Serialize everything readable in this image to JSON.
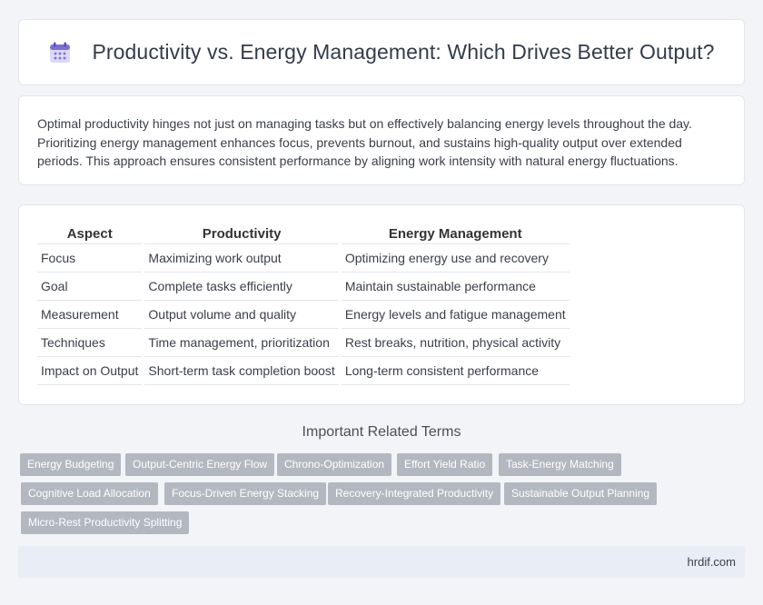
{
  "header": {
    "title": "Productivity vs. Energy Management: Which Drives Better Output?",
    "icon": "calendar-icon"
  },
  "intro": {
    "text": "Optimal productivity hinges not just on managing tasks but on effectively balancing energy levels throughout the day. Prioritizing energy management enhances focus, prevents burnout, and sustains high-quality output over extended periods. This approach ensures consistent performance by aligning work intensity with natural energy fluctuations."
  },
  "table": {
    "headers": [
      "Aspect",
      "Productivity",
      "Energy Management"
    ],
    "rows": [
      [
        "Focus",
        "Maximizing work output",
        "Optimizing energy use and recovery"
      ],
      [
        "Goal",
        "Complete tasks efficiently",
        "Maintain sustainable performance"
      ],
      [
        "Measurement",
        "Output volume and quality",
        "Energy levels and fatigue management"
      ],
      [
        "Techniques",
        "Time management, prioritization",
        "Rest breaks, nutrition, physical activity"
      ],
      [
        "Impact on Output",
        "Short-term task completion boost",
        "Long-term consistent performance"
      ]
    ]
  },
  "related": {
    "title": "Important Related Terms",
    "tags": [
      "Energy Budgeting",
      "Output-Centric Energy Flow",
      "Chrono-Optimization",
      "Effort Yield Ratio",
      "Task-Energy Matching",
      "Cognitive Load Allocation",
      "Focus-Driven Energy Stacking",
      "Recovery-Integrated Productivity",
      "Sustainable Output Planning",
      "Micro-Rest Productivity Splitting"
    ]
  },
  "footer": {
    "site": "hrdif.com"
  },
  "colors": {
    "background": "#f3f4f7",
    "card": "#ffffff",
    "tag": "#b3b8c0",
    "footer": "#e8edf6",
    "icon_accent": "#7b6fd6"
  }
}
